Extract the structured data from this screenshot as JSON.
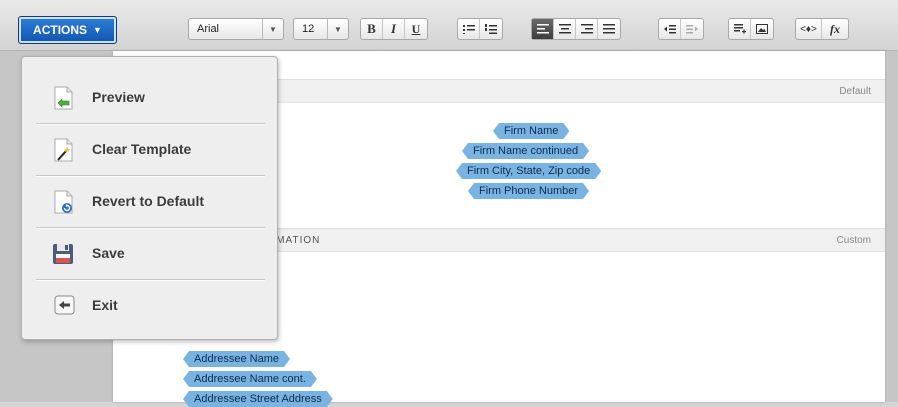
{
  "toolbar": {
    "actions_label": "ACTIONS",
    "font_family": "Arial",
    "font_size": "12",
    "bold_label": "B",
    "italic_label": "I",
    "underline_label": "U",
    "fx_label": "fx"
  },
  "menu": {
    "items": [
      {
        "label": "Preview",
        "icon": "preview-page-icon"
      },
      {
        "label": "Clear Template",
        "icon": "clear-wand-icon"
      },
      {
        "label": "Revert to Default",
        "icon": "revert-page-icon"
      },
      {
        "label": "Save",
        "icon": "floppy-disk-icon"
      },
      {
        "label": "Exit",
        "icon": "exit-arrow-icon"
      }
    ]
  },
  "document": {
    "section1": {
      "tag": "Default"
    },
    "section2": {
      "title": "RMATION",
      "tag": "Custom"
    },
    "firm_fields": [
      "Firm Name",
      "Firm Name continued",
      "Firm City, State, Zip code",
      "Firm Phone Number"
    ],
    "addressee_fields": [
      "Addressee Name",
      "Addressee Name cont.",
      "Addressee Street Address"
    ]
  },
  "colors": {
    "accent": "#1761c0",
    "field_fill": "#79b3e2",
    "active_button": "#4a4a4a"
  }
}
